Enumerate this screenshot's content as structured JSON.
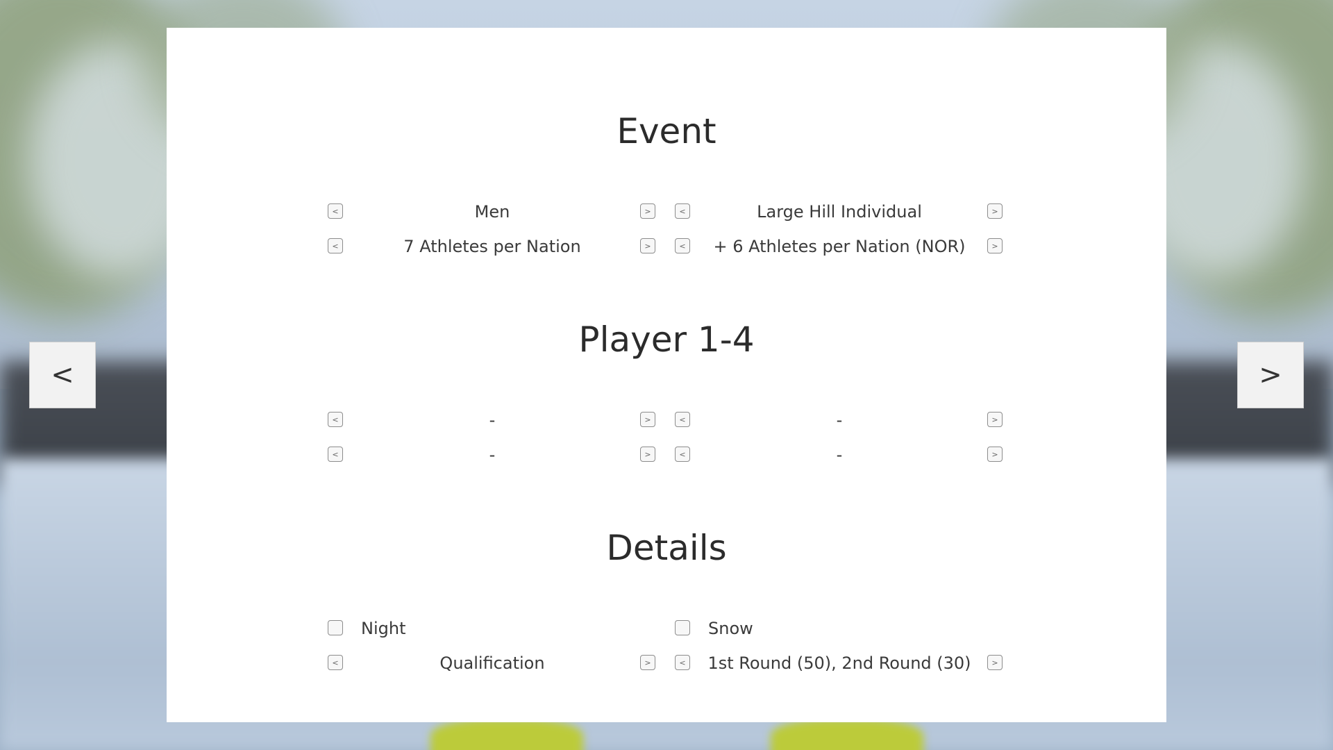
{
  "event": {
    "title": "Event",
    "rows": [
      {
        "left": "Men",
        "right": "Large Hill Individual"
      },
      {
        "left": "7 Athletes per Nation",
        "right": "+ 6 Athletes per Nation (NOR)"
      }
    ]
  },
  "players": {
    "title": "Player 1-4",
    "rows": [
      {
        "left": "-",
        "right": "-"
      },
      {
        "left": "-",
        "right": "-"
      }
    ]
  },
  "details": {
    "title": "Details",
    "checkboxes": {
      "left": "Night",
      "right": "Snow"
    },
    "row": {
      "left": "Qualification",
      "right": "1st Round (50), 2nd Round (30)"
    }
  },
  "arrows": {
    "prev": "<",
    "next": ">"
  },
  "nav": {
    "prev": "<",
    "next": ">"
  }
}
